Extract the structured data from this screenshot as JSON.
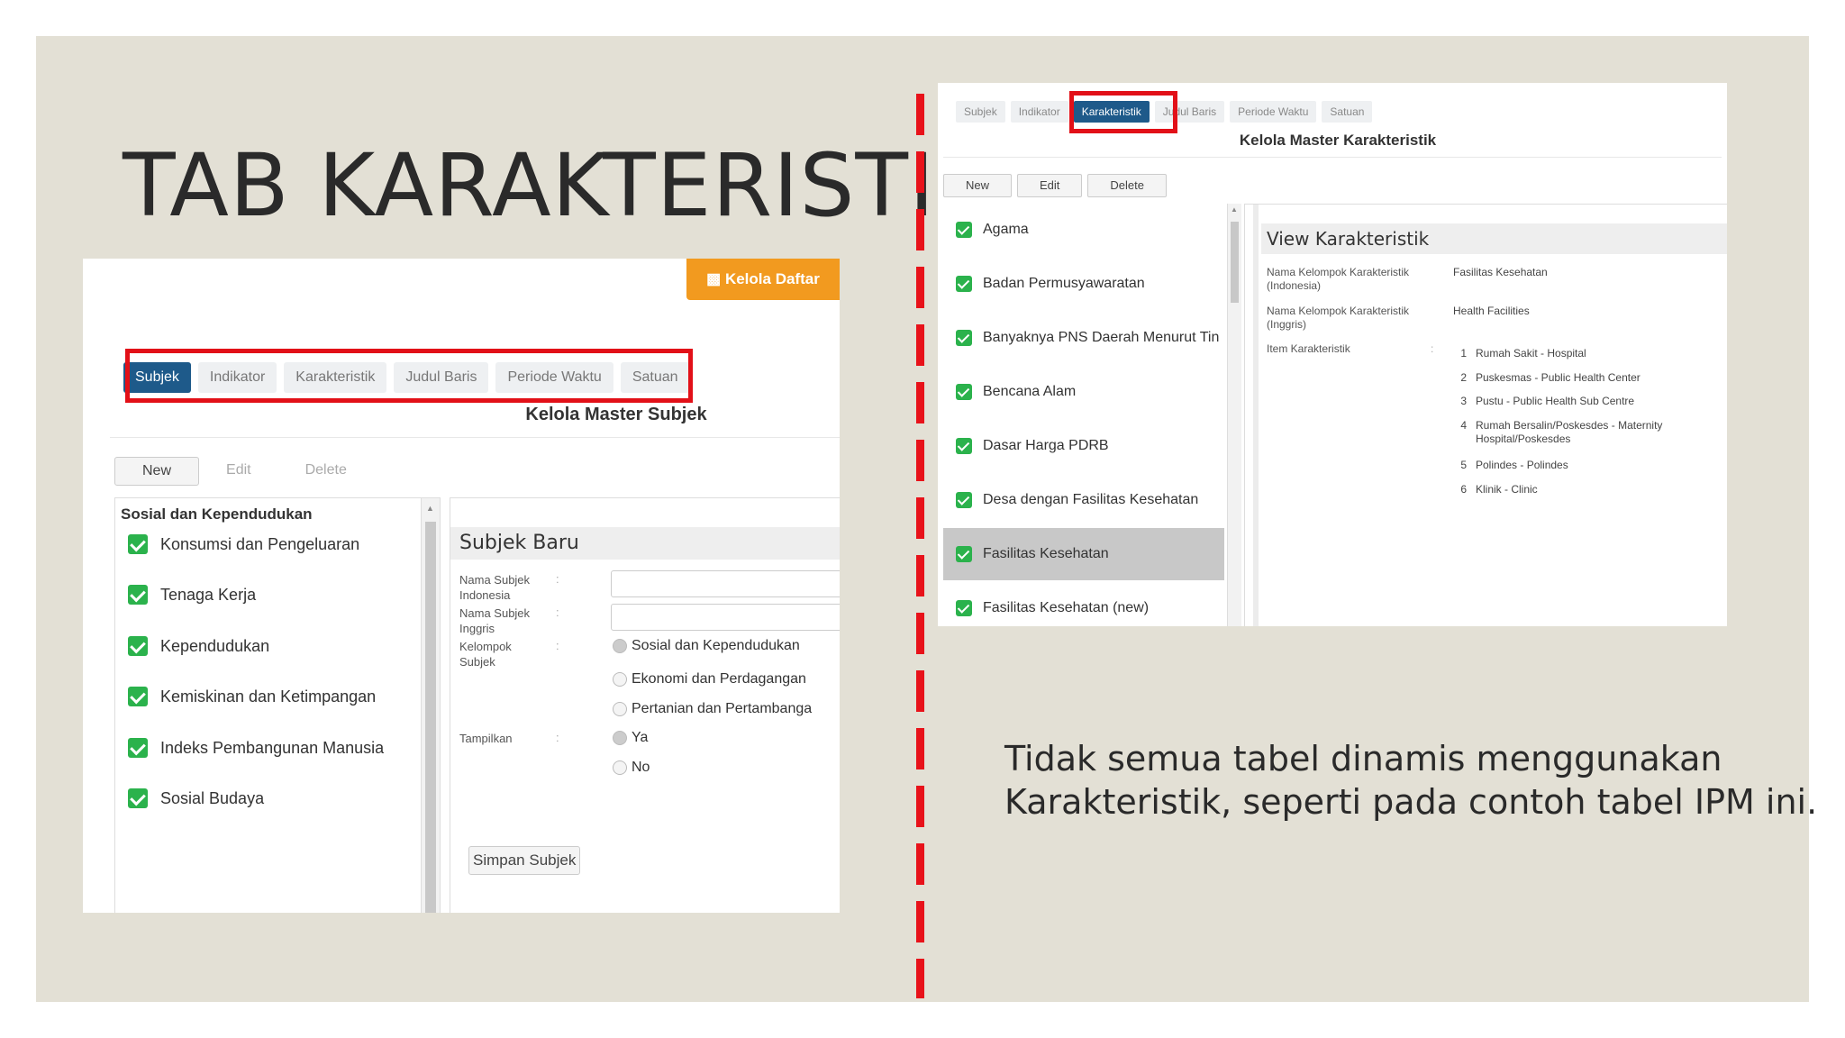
{
  "slide": {
    "title": "TAB KARAKTERISTIK",
    "caption": "Tidak semua tabel dinamis menggunakan Karakteristik, seperti pada contoh tabel IPM ini."
  },
  "left_screenshot": {
    "kelola_button": "Kelola Daftar",
    "tabs": [
      "Subjek",
      "Indikator",
      "Karakteristik",
      "Judul Baris",
      "Periode Waktu",
      "Satuan"
    ],
    "active_tab": "Subjek",
    "header": "Kelola Master Subjek",
    "buttons": {
      "new": "New",
      "edit": "Edit",
      "delete": "Delete"
    },
    "group": "Sosial dan Kependudukan",
    "items": [
      "Konsumsi dan Pengeluaran",
      "Tenaga Kerja",
      "Kependudukan",
      "Kemiskinan dan Ketimpangan",
      "Indeks Pembangunan Manusia",
      "Sosial Budaya"
    ],
    "form": {
      "title": "Subjek Baru",
      "labels": {
        "nama_indonesia": "Nama Subjek Indonesia",
        "nama_inggris": "Nama Subjek Inggris",
        "kelompok": "Kelompok Subjek",
        "tampilkan": "Tampilkan"
      },
      "colon": ":",
      "kelompok_options": [
        "Sosial dan Kependudukan",
        "Ekonomi dan Perdagangan",
        "Pertanian dan Pertambanga"
      ],
      "tampilkan_options": [
        "Ya",
        "No"
      ],
      "save": "Simpan Subjek"
    }
  },
  "right_screenshot": {
    "tabs": [
      "Subjek",
      "Indikator",
      "Karakteristik",
      "Judul Baris",
      "Periode Waktu",
      "Satuan"
    ],
    "active_tab": "Karakteristik",
    "header": "Kelola Master Karakteristik",
    "buttons": {
      "new": "New",
      "edit": "Edit",
      "delete": "Delete"
    },
    "items": [
      "Agama",
      "Badan Permusyawaratan",
      "Banyaknya PNS Daerah Menurut Tin",
      "Bencana Alam",
      "Dasar Harga PDRB",
      "Desa dengan Fasilitas Kesehatan",
      "Fasilitas Kesehatan",
      "Fasilitas Kesehatan (new)"
    ],
    "selected_item": "Fasilitas Kesehatan",
    "view": {
      "title": "View Karakteristik",
      "label_indonesia": "Nama Kelompok Karakteristik (Indonesia)",
      "value_indonesia": "Fasilitas Kesehatan",
      "label_inggris": "Nama Kelompok Karakteristik (Inggris)",
      "value_inggris": "Health Facilities",
      "label_items": "Item Karakteristik",
      "colon": ":",
      "items": [
        {
          "no": "1",
          "text": "Rumah Sakit - Hospital"
        },
        {
          "no": "2",
          "text": "Puskesmas - Public Health Center"
        },
        {
          "no": "3",
          "text": "Pustu - Public Health Sub Centre"
        },
        {
          "no": "4",
          "text": "Rumah Bersalin/Poskesdes - Maternity Hospital/Poskesdes"
        },
        {
          "no": "5",
          "text": "Polindes - Polindes"
        },
        {
          "no": "6",
          "text": "Klinik - Clinic"
        }
      ]
    }
  },
  "colors": {
    "slide_bg": "#e3e0d5",
    "divider": "#e8121a",
    "highlight_box": "#e21018",
    "active_tab": "#1e5a8a",
    "kelola_button": "#f29a1f",
    "checkbox": "#2bb24c"
  }
}
